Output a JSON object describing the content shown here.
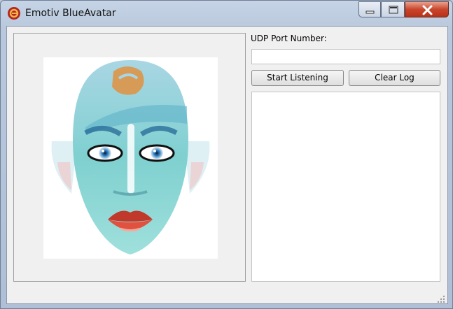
{
  "window": {
    "title": "Emotiv BlueAvatar",
    "app_icon": "emotiv-logo-icon",
    "controls": [
      "minimize-icon",
      "maximize-icon",
      "close-icon"
    ]
  },
  "form": {
    "port_label": "UDP Port Number:",
    "port_value": "",
    "start_button": "Start Listening",
    "clear_button": "Clear Log",
    "log_text": ""
  },
  "avatar": {
    "description_icon": "avatar-face-image"
  },
  "colors": {
    "close_button": "#c9452b",
    "face_teal": "#6fc9c9",
    "lips": "#c0392b",
    "logo_orange": "#e0913f"
  }
}
